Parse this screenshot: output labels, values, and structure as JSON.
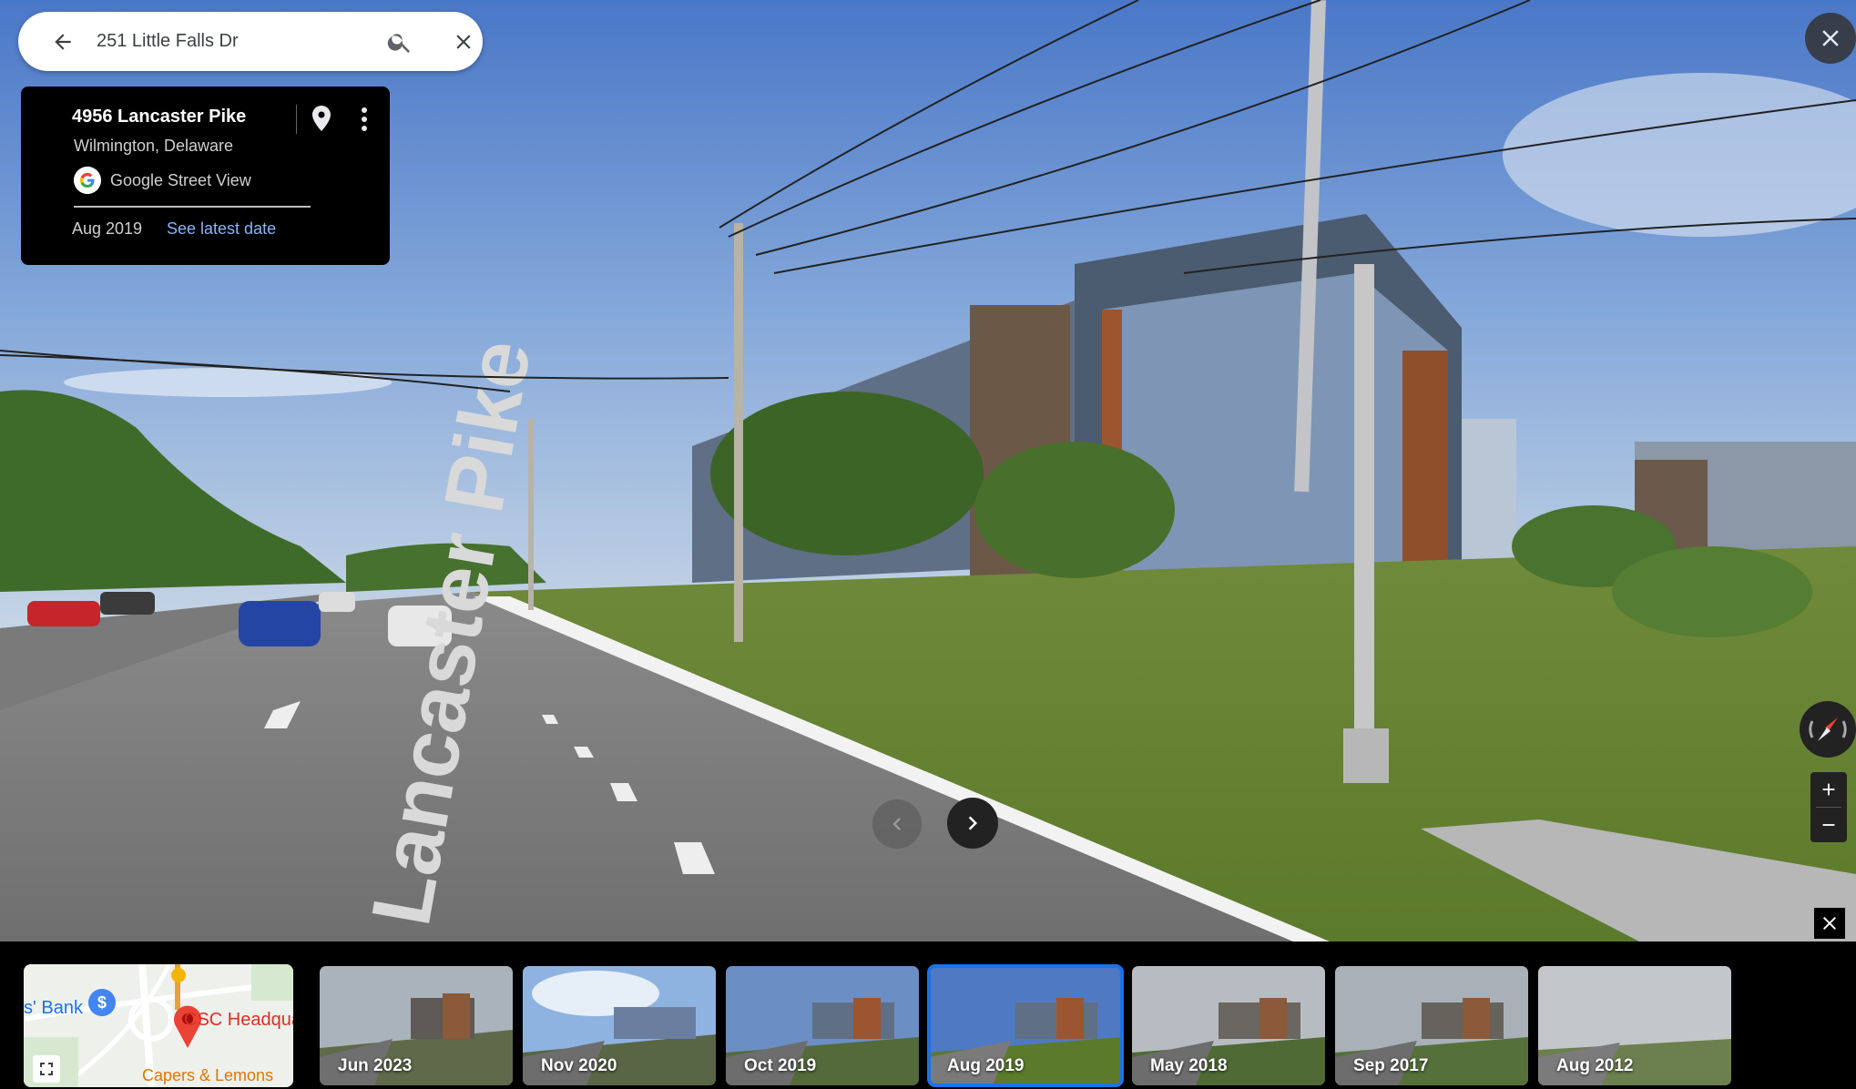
{
  "search": {
    "query": "251 Little Falls Dr"
  },
  "info_card": {
    "address": "4956 Lancaster Pike",
    "city": "Wilmington, Delaware",
    "source": "Google Street View",
    "date": "Aug 2019",
    "latest_link": "See latest date"
  },
  "minimap": {
    "bank_label": "s' Bank",
    "poi_label": "CSC Headquar",
    "restaurant_label": "Capers & Lemons"
  },
  "timeline": [
    {
      "label": "Jun 2023",
      "selected": false
    },
    {
      "label": "Nov 2020",
      "selected": false
    },
    {
      "label": "Oct 2019",
      "selected": false
    },
    {
      "label": "Aug 2019",
      "selected": true
    },
    {
      "label": "May 2018",
      "selected": false
    },
    {
      "label": "Sep 2017",
      "selected": false
    },
    {
      "label": "Aug 2012",
      "selected": false
    }
  ],
  "colors": {
    "accent": "#1a73e8",
    "link": "#8ab4f8"
  }
}
